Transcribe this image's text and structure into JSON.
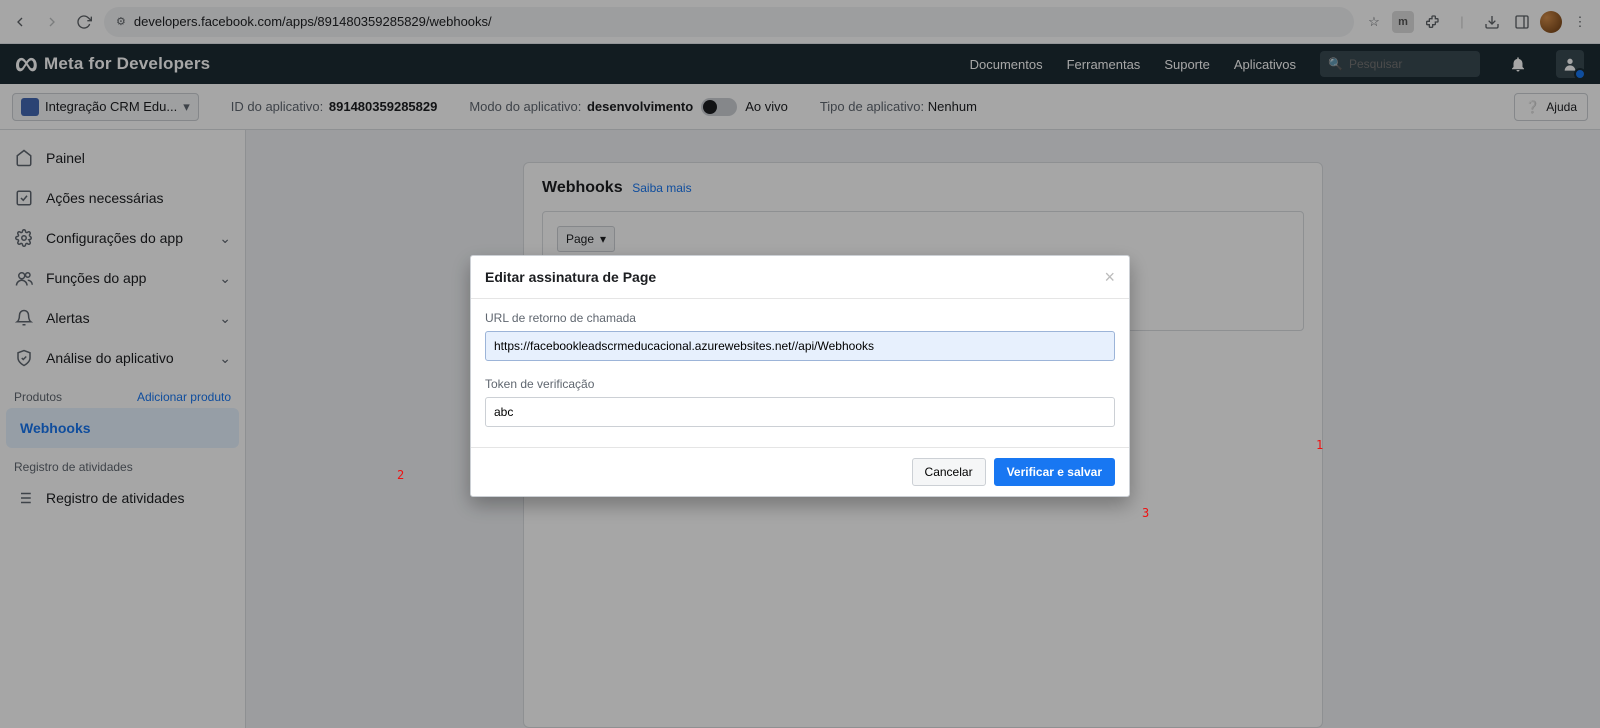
{
  "browser": {
    "url": "developers.facebook.com/apps/891480359285829/webhooks/"
  },
  "topnav": {
    "brand": "Meta for Developers",
    "links": {
      "docs": "Documentos",
      "tools": "Ferramentas",
      "support": "Suporte",
      "apps": "Aplicativos"
    },
    "search_placeholder": "Pesquisar"
  },
  "appbar": {
    "app_name": "Integração CRM Edu...",
    "id_label": "ID do aplicativo:",
    "id_value": "891480359285829",
    "mode_label": "Modo do aplicativo:",
    "mode_dev": "desenvolvimento",
    "mode_live": "Ao vivo",
    "type_label": "Tipo de aplicativo:",
    "type_value": "Nenhum",
    "help": "Ajuda"
  },
  "sidebar": {
    "items": {
      "dashboard": "Painel",
      "required": "Ações necessárias",
      "settings": "Configurações do app",
      "roles": "Funções do app",
      "alerts": "Alertas",
      "review": "Análise do aplicativo"
    },
    "products_label": "Produtos",
    "add_product": "Adicionar produto",
    "webhooks": "Webhooks",
    "activity_section": "Registro de atividades",
    "activity_item": "Registro de atividades"
  },
  "main": {
    "title": "Webhooks",
    "learn_more": "Saiba mais",
    "page_dropdown": "Page"
  },
  "modal": {
    "title": "Editar assinatura de Page",
    "url_label": "URL de retorno de chamada",
    "url_value": "https://facebookleadscrmeducacional.azurewebsites.net//api/Webhooks",
    "token_label": "Token de verificação",
    "token_value": "abc",
    "cancel": "Cancelar",
    "save": "Verificar e salvar"
  },
  "annotations": {
    "n1": "1",
    "n2": "2",
    "n3": "3"
  }
}
